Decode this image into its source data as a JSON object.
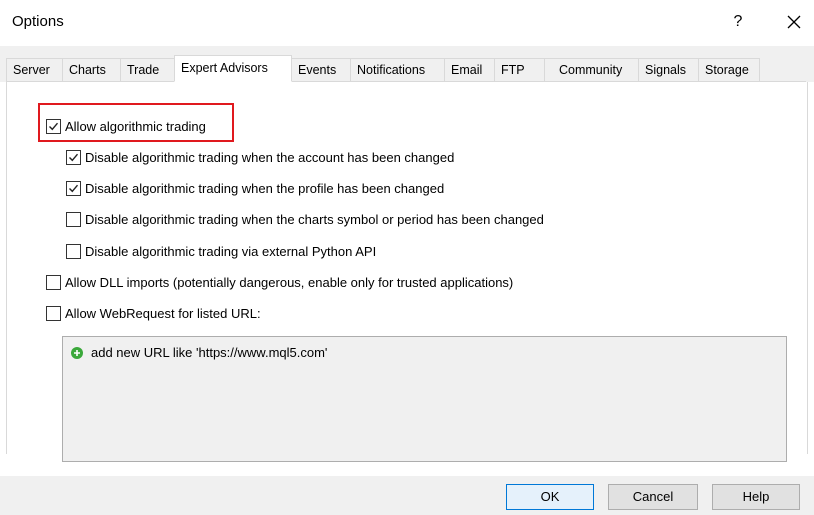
{
  "window": {
    "title": "Options",
    "help_label": "?"
  },
  "tabs": [
    {
      "label": "Server"
    },
    {
      "label": "Charts"
    },
    {
      "label": "Trade"
    },
    {
      "label": "Expert Advisors",
      "active": true
    },
    {
      "label": "Events"
    },
    {
      "label": "Notifications"
    },
    {
      "label": "Email"
    },
    {
      "label": "FTP"
    },
    {
      "label": "Community"
    },
    {
      "label": "Signals"
    },
    {
      "label": "Storage"
    }
  ],
  "options": {
    "allow_algo": {
      "label": "Allow algorithmic trading",
      "checked": true
    },
    "disable_account": {
      "label": "Disable algorithmic trading when the account has been changed",
      "checked": true
    },
    "disable_profile": {
      "label": "Disable algorithmic trading when the profile has been changed",
      "checked": true
    },
    "disable_symbol": {
      "label": "Disable algorithmic trading when the charts symbol or period has been changed",
      "checked": false
    },
    "disable_python": {
      "label": "Disable algorithmic trading via external Python API",
      "checked": false
    },
    "allow_dll": {
      "label": "Allow DLL imports (potentially dangerous, enable only for trusted applications)",
      "checked": false
    },
    "allow_webrequest": {
      "label": "Allow WebRequest for listed URL:",
      "checked": false
    }
  },
  "url_list": {
    "add_item_label": "add new URL like 'https://www.mql5.com'"
  },
  "buttons": {
    "ok": "OK",
    "cancel": "Cancel",
    "help": "Help"
  },
  "colors": {
    "highlight_border": "#e0191e",
    "add_icon": "#3aa83a",
    "default_button_border": "#0078d7"
  }
}
